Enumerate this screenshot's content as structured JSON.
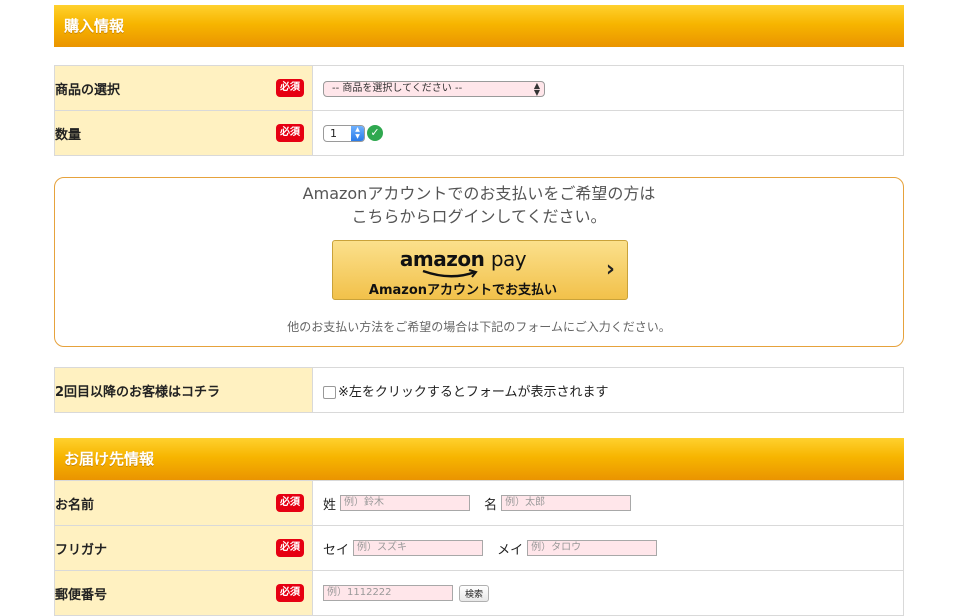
{
  "purchase": {
    "header": "購入情報",
    "required_badge": "必須",
    "product_label": "商品の選択",
    "product_select_value": "-- 商品を選択してください --",
    "quantity_label": "数量",
    "quantity_value": "1"
  },
  "amazon": {
    "lead_line1": "Amazonアカウントでのお支払いをご希望の方は",
    "lead_line2": "こちらからログインしてください。",
    "logo_word": "amazon",
    "logo_pay": "pay",
    "button_caption": "Amazonアカウントでお支払い",
    "note": "他のお支払い方法をご希望の場合は下記のフォームにご入力ください。"
  },
  "returning": {
    "label": "2回目以降のお客様はコチラ",
    "checkbox_text": "※左をクリックするとフォームが表示されます"
  },
  "delivery": {
    "header": "お届け先情報",
    "required_badge": "必須",
    "name_label": "お名前",
    "last_name_label": "姓",
    "last_name_placeholder": "例）鈴木",
    "first_name_label": "名",
    "first_name_placeholder": "例）太郎",
    "kana_label": "フリガナ",
    "last_kana_label": "セイ",
    "last_kana_placeholder": "例）スズキ",
    "first_kana_label": "メイ",
    "first_kana_placeholder": "例）タロウ",
    "postal_label": "郵便番号",
    "postal_placeholder": "例）1112222",
    "search_button": "検索"
  },
  "colors": {
    "header_gradient_top": "#ffd12e",
    "header_gradient_bottom": "#ea9400",
    "label_bg": "#fff1c1",
    "required_bg": "#e60012",
    "input_bg": "#ffe6ea",
    "amazon_border": "#e6a23c"
  }
}
